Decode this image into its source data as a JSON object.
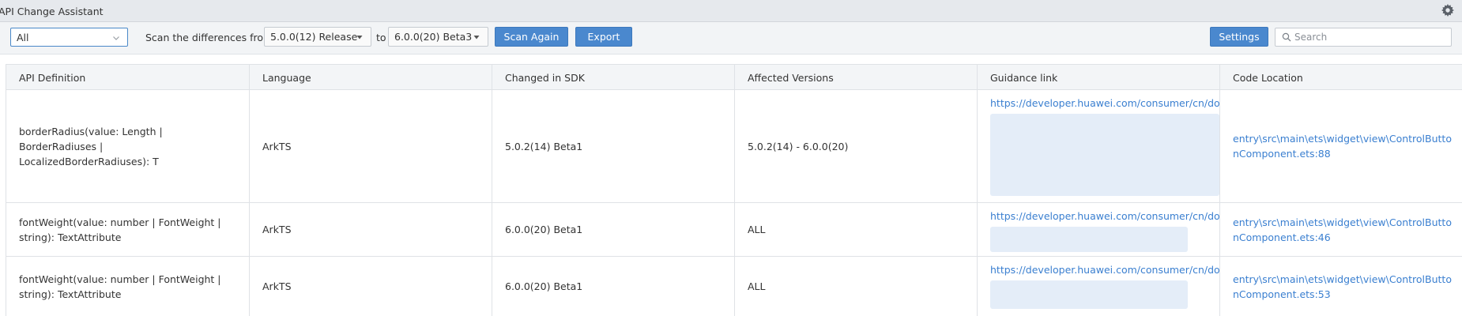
{
  "window": {
    "title": "API Change Assistant"
  },
  "toolbar": {
    "filter_value": "All",
    "scan_label": "Scan the differences from",
    "from_version": "5.0.0(12) Release",
    "to_label": "to",
    "to_version": "6.0.0(20) Beta3",
    "scan_again_label": "Scan Again",
    "export_label": "Export",
    "settings_label": "Settings",
    "search_placeholder": "Search"
  },
  "table": {
    "columns": [
      "API Definition",
      "Language",
      "Changed in SDK",
      "Affected Versions",
      "Guidance link",
      "Code Location"
    ],
    "rows": [
      {
        "api": "borderRadius(value: Length | BorderRadiuses | LocalizedBorderRadiuses): T",
        "language": "ArkTS",
        "changed_in": "5.0.2(14) Beta1",
        "affected": "5.0.2(14) - 6.0.0(20)",
        "guidance": "https://developer.huawei.com/consumer/cn/do",
        "location": "entry\\src\\main\\ets\\widget\\view\\ControlButtonComponent.ets:88"
      },
      {
        "api": "fontWeight(value: number | FontWeight | string): TextAttribute",
        "language": "ArkTS",
        "changed_in": "6.0.0(20) Beta1",
        "affected": "ALL",
        "guidance": "https://developer.huawei.com/consumer/cn/do",
        "location": "entry\\src\\main\\ets\\widget\\view\\ControlButtonComponent.ets:46"
      },
      {
        "api": "fontWeight(value: number | FontWeight | string): TextAttribute",
        "language": "ArkTS",
        "changed_in": "6.0.0(20) Beta1",
        "affected": "ALL",
        "guidance": "https://developer.huawei.com/consumer/cn/do",
        "location": "entry\\src\\main\\ets\\widget\\view\\ControlButtonComponent.ets:53"
      }
    ]
  },
  "icons": {
    "settings": "gear-icon",
    "search": "search-icon",
    "dropdown": "chevron-down-icon"
  },
  "colors": {
    "accent": "#4a88ce",
    "link": "#3a7fd0"
  }
}
